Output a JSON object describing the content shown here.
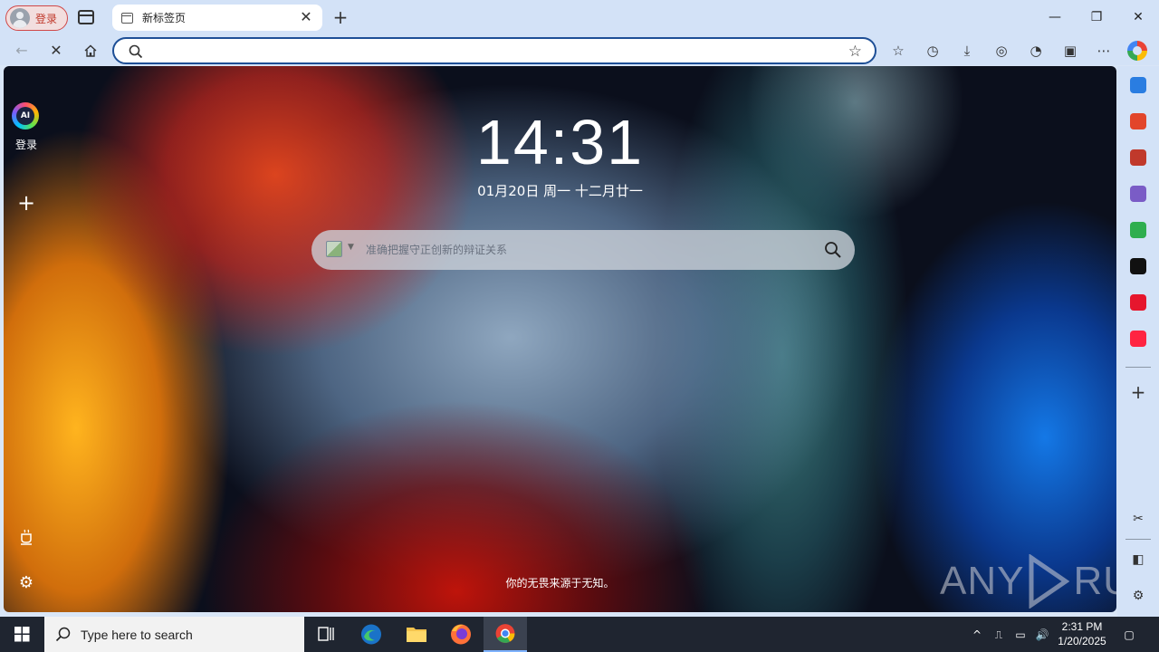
{
  "browser": {
    "profile_label": "登录",
    "tab_title": "新标签页",
    "tab_close_glyph": "✕",
    "new_tab_glyph": "+",
    "window": {
      "minimize": "—",
      "maximize": "❐",
      "close": "✕"
    },
    "nav": {
      "back_glyph": "←",
      "stop_glyph": "✕"
    },
    "address": {
      "value": "",
      "placeholder": ""
    },
    "star_glyph": "☆",
    "toolbar_glyphs": [
      "☆",
      "◷",
      "⤓",
      "◎",
      "◔",
      "▣",
      "⋯"
    ]
  },
  "newtab": {
    "left_login": "登录",
    "left_plus": "+",
    "clock": "14:31",
    "date_line": "01月20日 周一 十二月廿一",
    "search_placeholder": "准确把握守正创新的辩证关系",
    "quote": "你的无畏来源于无知。",
    "settings_glyph": "⚙"
  },
  "watermark": {
    "left": "ANY",
    "right": "RUN"
  },
  "sidebar": {
    "items": [
      {
        "name": "gift-tag",
        "color": "#2a7de1"
      },
      {
        "name": "office",
        "color": "#e2452b"
      },
      {
        "name": "toolbox",
        "color": "#c0392b"
      },
      {
        "name": "chess",
        "color": "#7a5cc6"
      },
      {
        "name": "apps",
        "color": "#2fae4f"
      },
      {
        "name": "tiktok",
        "color": "#111111"
      },
      {
        "name": "weibo",
        "color": "#e6162d"
      },
      {
        "name": "xiaohongshu",
        "color": "#ff2442"
      }
    ],
    "plus_glyph": "+",
    "screenshot_glyph": "✂",
    "panel_glyph": "◧",
    "settings_glyph": "⚙"
  },
  "taskbar": {
    "search_placeholder": "Type here to search",
    "time": "2:31 PM",
    "date": "1/20/2025",
    "tray_glyphs": [
      "^",
      "⎍",
      "▭",
      "🔊",
      "▢"
    ]
  }
}
